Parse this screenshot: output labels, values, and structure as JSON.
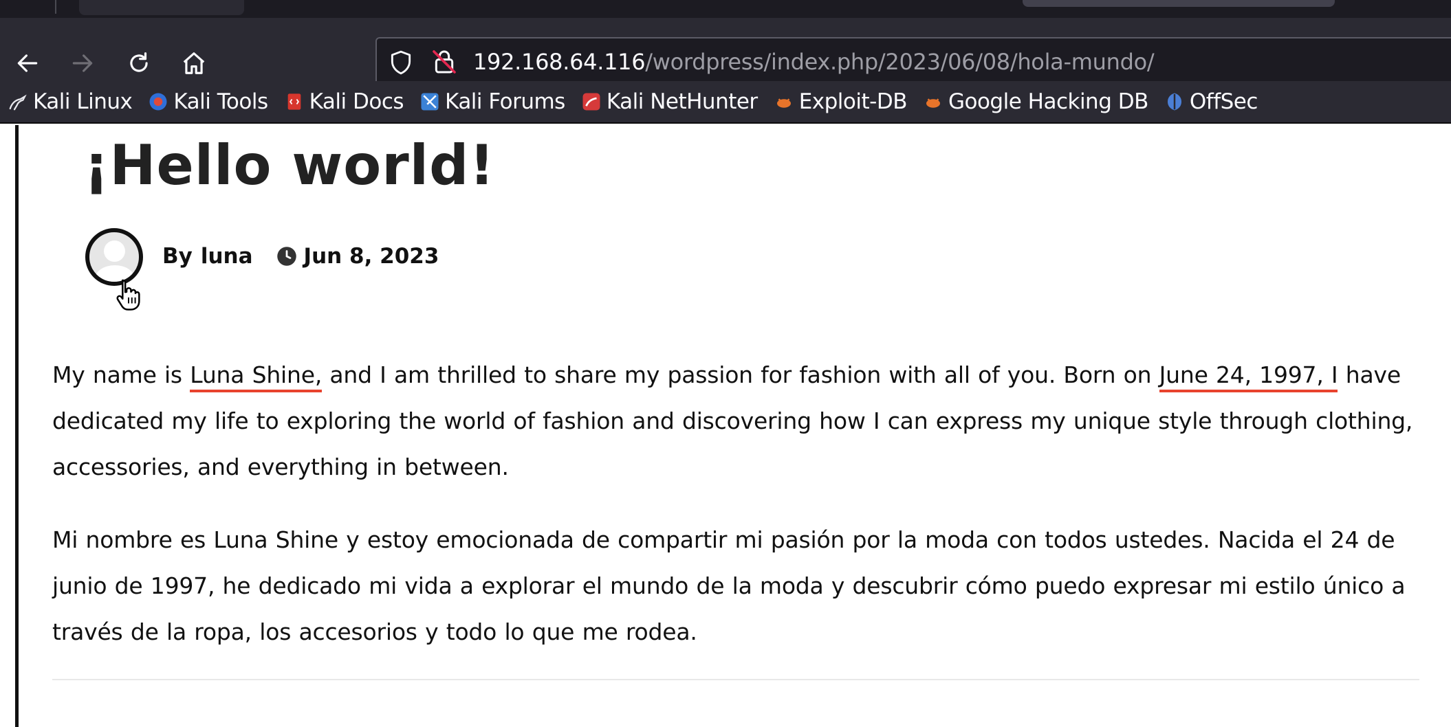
{
  "browser": {
    "url_host": "192.168.64.116",
    "url_path": "/wordpress/index.php/2023/06/08/hola-mundo/",
    "bookmarks": [
      {
        "label": "Kali Linux",
        "icon": "kali-dragon-icon"
      },
      {
        "label": "Kali Tools",
        "icon": "kali-tools-icon"
      },
      {
        "label": "Kali Docs",
        "icon": "kali-docs-icon"
      },
      {
        "label": "Kali Forums",
        "icon": "kali-forums-icon"
      },
      {
        "label": "Kali NetHunter",
        "icon": "kali-nethunter-icon"
      },
      {
        "label": "Exploit-DB",
        "icon": "exploit-db-icon"
      },
      {
        "label": "Google Hacking DB",
        "icon": "ghdb-icon"
      },
      {
        "label": "OffSec",
        "icon": "offsec-icon"
      }
    ]
  },
  "post": {
    "title": "¡Hello world!",
    "by_prefix": "By",
    "author": "luna",
    "date": "Jun 8, 2023",
    "paragraph_en": {
      "part1": "My name is ",
      "name": "Luna Shine,",
      "part2": " and I am thrilled to share my passion for fashion with all of you. Born on ",
      "birthdate": "June 24, 1997, I",
      "part3": " have dedicated my life to exploring the world of fashion and discovering how I can express my unique style through clothing, accessories, and everything in between."
    },
    "paragraph_es": "Mi nombre es Luna Shine y estoy emocionada de compartir mi pasión por la moda con todos ustedes. Nacida el 24 de junio de 1997, he dedicado mi vida a explorar el mundo de la moda y descubrir cómo puedo expresar mi estilo único a través de la ropa, los accesorios y todo lo que me rodea."
  },
  "colors": {
    "underline_annotation": "#e8432e",
    "chrome_bg": "#2b2a33",
    "url_field_bg": "#1c1b22"
  }
}
